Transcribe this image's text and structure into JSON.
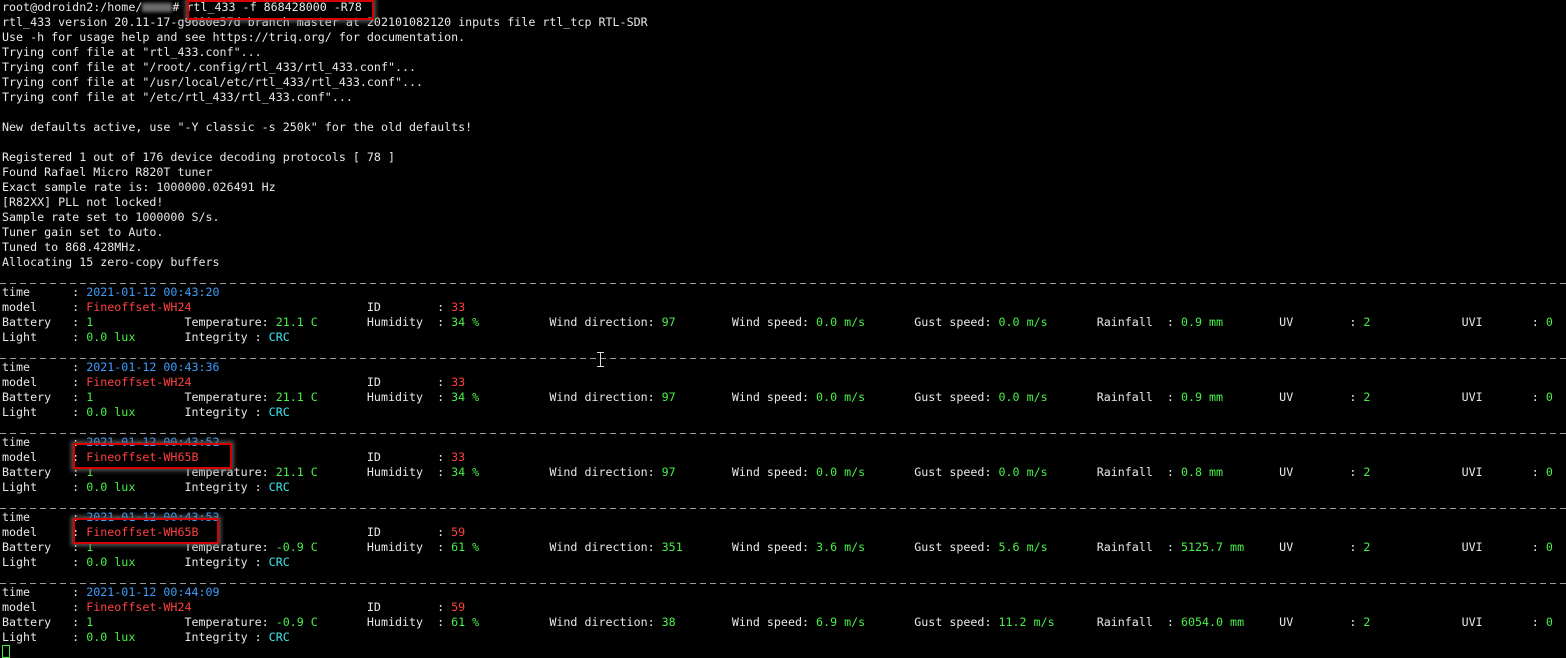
{
  "prompt": {
    "user_host_path": "root@odroidn2:/home/",
    "prompt_end": "# ",
    "command": "rtl_433 -f 868428000 -R78"
  },
  "output_lines": [
    "rtl_433 version 20.11-17-g9680e57d branch master at 202101082120 inputs file rtl_tcp RTL-SDR",
    "Use -h for usage help and see https://triq.org/ for documentation.",
    "Trying conf file at \"rtl_433.conf\"...",
    "Trying conf file at \"/root/.config/rtl_433/rtl_433.conf\"...",
    "Trying conf file at \"/usr/local/etc/rtl_433/rtl_433.conf\"...",
    "Trying conf file at \"/etc/rtl_433/rtl_433.conf\"...",
    "",
    "New defaults active, use \"-Y classic -s 250k\" for the old defaults!",
    "",
    "Registered 1 out of 176 device decoding protocols [ 78 ]",
    "Found Rafael Micro R820T tuner",
    "Exact sample rate is: 1000000.026491 Hz",
    "[R82XX] PLL not locked!",
    "Sample rate set to 1000000 S/s.",
    "Tuner gain set to Auto.",
    "Tuned to 868.428MHz.",
    "Allocating 15 zero-copy buffers"
  ],
  "labels": {
    "time": "time",
    "model": "model",
    "id": "ID",
    "battery": "Battery",
    "temperature": "Temperature",
    "humidity": "Humidity",
    "wind_direction": "Wind direction",
    "wind_speed": "Wind speed",
    "gust_speed": "Gust speed",
    "rainfall": "Rainfall",
    "uv": "UV",
    "uvi": "UVI",
    "light": "Light",
    "integrity": "Integrity"
  },
  "records": [
    {
      "time": "2021-01-12 00:43:20",
      "model": "Fineoffset-WH24",
      "id": "33",
      "battery": "1",
      "temperature": "21.1 C",
      "humidity": "34 %",
      "wind_direction": "97",
      "wind_speed": "0.0 m/s",
      "gust_speed": "0.0 m/s",
      "rainfall": "0.9 mm",
      "uv": "2",
      "uvi": "0",
      "light": "0.0 lux",
      "integrity": "CRC",
      "highlighted": false
    },
    {
      "time": "2021-01-12 00:43:36",
      "model": "Fineoffset-WH24",
      "id": "33",
      "battery": "1",
      "temperature": "21.1 C",
      "humidity": "34 %",
      "wind_direction": "97",
      "wind_speed": "0.0 m/s",
      "gust_speed": "0.0 m/s",
      "rainfall": "0.9 mm",
      "uv": "2",
      "uvi": "0",
      "light": "0.0 lux",
      "integrity": "CRC",
      "highlighted": false
    },
    {
      "time": "2021-01-12 00:43:52",
      "model": "Fineoffset-WH65B",
      "id": "33",
      "battery": "1",
      "temperature": "21.1 C",
      "humidity": "34 %",
      "wind_direction": "97",
      "wind_speed": "0.0 m/s",
      "gust_speed": "0.0 m/s",
      "rainfall": "0.8 mm",
      "uv": "2",
      "uvi": "0",
      "light": "0.0 lux",
      "integrity": "CRC",
      "highlighted": true
    },
    {
      "time": "2021-01-12 00:43:53",
      "model": "Fineoffset-WH65B",
      "id": "59",
      "battery": "1",
      "temperature": "-0.9 C",
      "humidity": "61 %",
      "wind_direction": "351",
      "wind_speed": "3.6 m/s",
      "gust_speed": "5.6 m/s",
      "rainfall": "5125.7 mm",
      "uv": "2",
      "uvi": "0",
      "light": "0.0 lux",
      "integrity": "CRC",
      "highlighted": true
    },
    {
      "time": "2021-01-12 00:44:09",
      "model": "Fineoffset-WH24",
      "id": "59",
      "battery": "1",
      "temperature": "-0.9 C",
      "humidity": "61 %",
      "wind_direction": "38",
      "wind_speed": "6.9 m/s",
      "gust_speed": "11.2 m/s",
      "rainfall": "6054.0 mm",
      "uv": "2",
      "uvi": "0",
      "light": "0.0 lux",
      "integrity": "CRC",
      "highlighted": false
    }
  ],
  "colors": {
    "time": "#3d9dfa",
    "model": "#ff4040",
    "value": "#48f048",
    "integrity": "#3ce8f0",
    "highlight": "#d60000",
    "background": "#000000"
  }
}
